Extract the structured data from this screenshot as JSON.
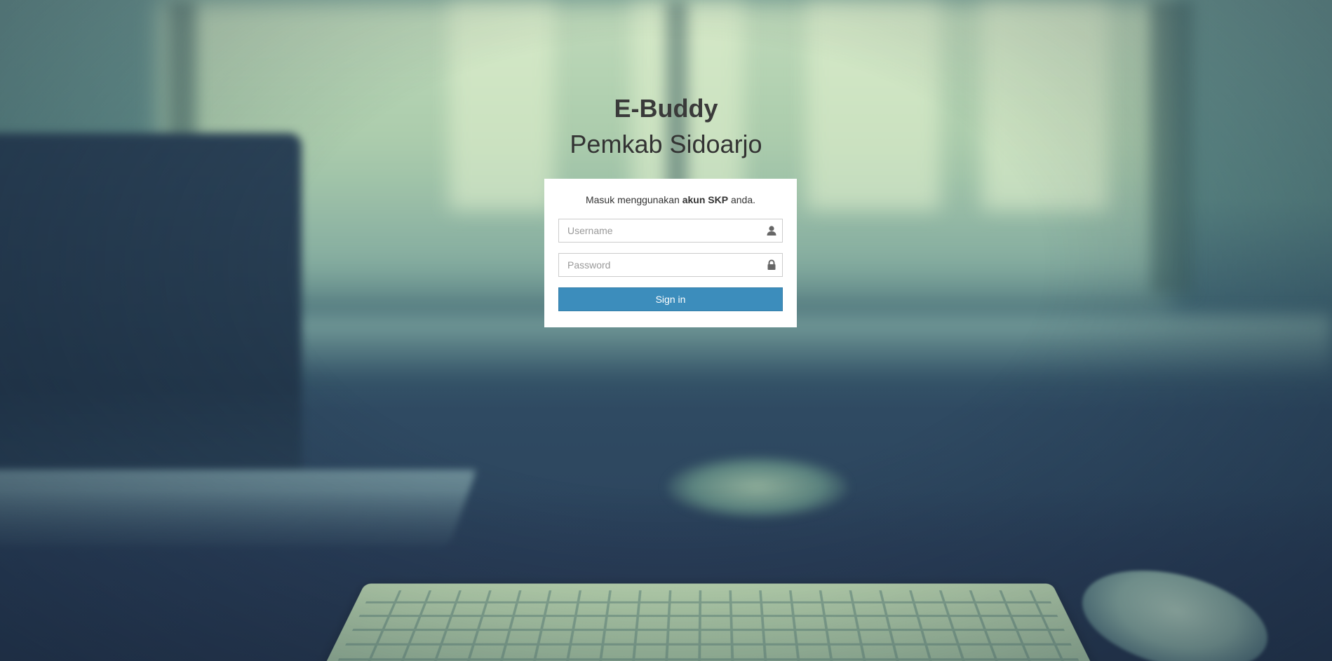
{
  "brand": {
    "title": "E-Buddy",
    "subtitle": "Pemkab Sidoarjo"
  },
  "login": {
    "message_prefix": "Masuk menggunakan ",
    "message_bold": "akun SKP",
    "message_suffix": " anda.",
    "username_placeholder": "Username",
    "username_icon": "user-icon",
    "password_placeholder": "Password",
    "password_icon": "lock-icon",
    "signin_label": "Sign in"
  },
  "colors": {
    "primary_button": "#3c8dbc",
    "panel": "#ffffff",
    "title_text": "#333333"
  }
}
